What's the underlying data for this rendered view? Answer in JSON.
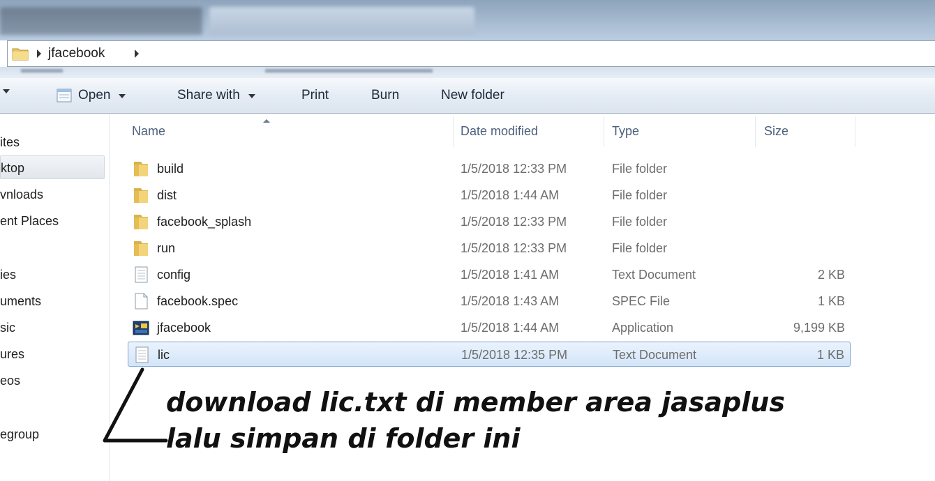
{
  "address": {
    "crumb": "jfacebook"
  },
  "toolbar": {
    "open": "Open",
    "share_with": "Share with",
    "print": "Print",
    "burn": "Burn",
    "new_folder": "New folder"
  },
  "nav": {
    "items": [
      "ites",
      "ktop",
      "vnloads",
      "ent Places",
      "ies",
      "uments",
      "sic",
      "ures",
      "eos",
      "egroup"
    ]
  },
  "columns": {
    "name": "Name",
    "date": "Date modified",
    "type": "Type",
    "size": "Size"
  },
  "files": [
    {
      "name": "build",
      "date": "1/5/2018 12:33 PM",
      "type": "File folder",
      "size": "",
      "icon": "folder-icon"
    },
    {
      "name": "dist",
      "date": "1/5/2018 1:44 AM",
      "type": "File folder",
      "size": "",
      "icon": "folder-icon"
    },
    {
      "name": "facebook_splash",
      "date": "1/5/2018 12:33 PM",
      "type": "File folder",
      "size": "",
      "icon": "folder-icon"
    },
    {
      "name": "run",
      "date": "1/5/2018 12:33 PM",
      "type": "File folder",
      "size": "",
      "icon": "folder-icon"
    },
    {
      "name": "config",
      "date": "1/5/2018 1:41 AM",
      "type": "Text Document",
      "size": "2 KB",
      "icon": "text-document-icon"
    },
    {
      "name": "facebook.spec",
      "date": "1/5/2018 1:43 AM",
      "type": "SPEC File",
      "size": "1 KB",
      "icon": "file-icon"
    },
    {
      "name": "jfacebook",
      "date": "1/5/2018 1:44 AM",
      "type": "Application",
      "size": "9,199 KB",
      "icon": "application-icon"
    },
    {
      "name": "lic",
      "date": "1/5/2018 12:35 PM",
      "type": "Text Document",
      "size": "1 KB",
      "icon": "text-document-icon"
    }
  ],
  "annotation": {
    "line1": "download lic.txt di member area jasaplus",
    "line2": "lalu simpan di folder ini"
  },
  "colors": {
    "selection_border": "#7da2ce",
    "selection_fill": "#d3e5f9",
    "header_text": "#4c607a"
  }
}
